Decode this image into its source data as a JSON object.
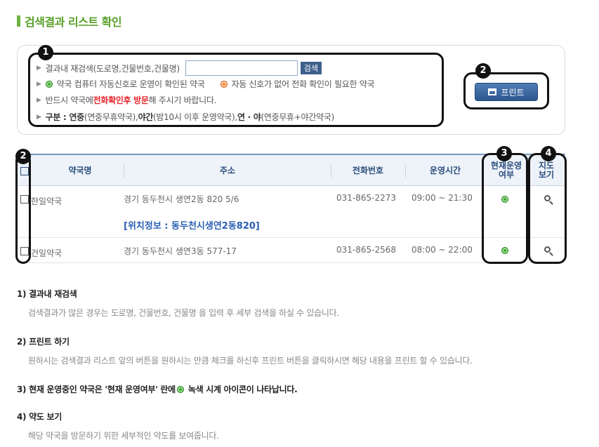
{
  "title": "검색결과 리스트 확인",
  "search": {
    "label": "결과내 재검색(도로명,건물번호,건물명)",
    "placeholder": "",
    "button": "검색",
    "legend_green": "약국 컴퓨터 자동신호로 운영이 확인된 약국",
    "legend_orange": "자동 신호가 없어 전화 확인이 필요한 약국",
    "notice_pre": "반드시 약국에 ",
    "notice_red": "전화확인후 방문",
    "notice_post": "해 주시기 바랍니다.",
    "cat_label": "구분 : 연중",
    "cat_1": "(연중무휴약국), ",
    "cat_2_b": "야간",
    "cat_2": "(밤10시 이후 운영약국), ",
    "cat_3_b": "연 · 야",
    "cat_3": "(연중무휴+야간약국)"
  },
  "print_button": "프린트",
  "callouts": {
    "c1": "1",
    "c2a": "2",
    "c2b": "2",
    "c3": "3",
    "c4": "4"
  },
  "table": {
    "headers": {
      "name": "약국명",
      "address": "주소",
      "phone": "전화번호",
      "hours": "운영시간",
      "status_1": "현재운영",
      "status_2": "여부",
      "map_1": "지도",
      "map_2": "보기"
    },
    "rows": [
      {
        "name": "한일약국",
        "address": "경기 동두천시 생연2동 820 5/6",
        "phone": "031-865-2273",
        "hours": "09:00 ~ 21:30",
        "location": "[위치정보 : 동두천시생연2동820]",
        "status": "green"
      },
      {
        "name": "건일약국",
        "address": "경기 동두천시 생연3동 577-17",
        "phone": "031-865-2568",
        "hours": "08:00 ~ 22:00",
        "status": "green"
      }
    ]
  },
  "help": [
    {
      "title": "1) 결과내 재검색",
      "desc": "검색결과가 많은 경우는 도로명, 건물번호, 건물명 을 입력 후 세부 검색을 하실 수 있습니다."
    },
    {
      "title": "2) 프린트 하기",
      "desc": "원하시는 검색결과 리스트 앞의 버튼을 원하시는 만큼 체크를 하신후 프린트 버튼을 클릭하시면 해당 내용을 프린트 할 수 있습니다."
    },
    {
      "title_pre": "3) 현재 운영중인 약국은 '현재 운영여부' 란에 ",
      "title_post": "녹색 시계 아이콘이 나타납니다."
    },
    {
      "title": "4) 약도 보기",
      "desc": "해당 약국을 방문하기 위한 세부적인 약도를 보여줍니다."
    }
  ],
  "colors": {
    "accent_green": "#59a12a",
    "header_blue": "#2a4d7c",
    "callout": "#111111",
    "status_green": "#3faa35",
    "status_orange": "#f48a3a"
  }
}
